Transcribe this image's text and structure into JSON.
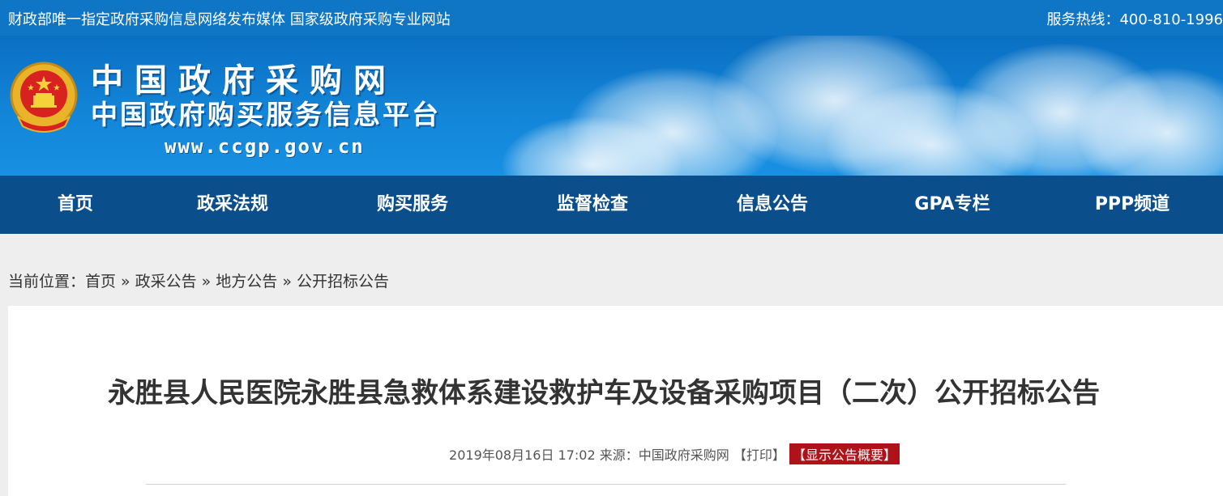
{
  "topbar": {
    "slogan": "财政部唯一指定政府采购信息网络发布媒体 国家级政府采购专业网站",
    "hotline": "服务热线：400-810-1996"
  },
  "header": {
    "logo_line1": "中国政府采购网",
    "logo_line2": "中国政府购买服务信息平台",
    "logo_url": "www.ccgp.gov.cn",
    "emblem_icon": "national-emblem-icon"
  },
  "nav": {
    "items": [
      {
        "label": "首页"
      },
      {
        "label": "政采法规"
      },
      {
        "label": "购买服务"
      },
      {
        "label": "监督检查"
      },
      {
        "label": "信息公告"
      },
      {
        "label": "GPA专栏"
      },
      {
        "label": "PPP频道"
      }
    ]
  },
  "breadcrumb": {
    "prefix": "当前位置：",
    "items": [
      {
        "label": "首页"
      },
      {
        "label": "政采公告"
      },
      {
        "label": "地方公告"
      },
      {
        "label": "公开招标公告"
      }
    ],
    "separator": "»"
  },
  "article": {
    "title": "永胜县人民医院永胜县急救体系建设救护车及设备采购项目（二次）公开招标公告",
    "datetime": "2019年08月16日 17:02",
    "source": "来源：中国政府采购网",
    "print_label": "【打印】",
    "summary_label": "【显示公告概要】"
  },
  "colors": {
    "topbar": "#0f76c5",
    "nav": "#0b4e8c",
    "summary_button": "#b0121a"
  }
}
